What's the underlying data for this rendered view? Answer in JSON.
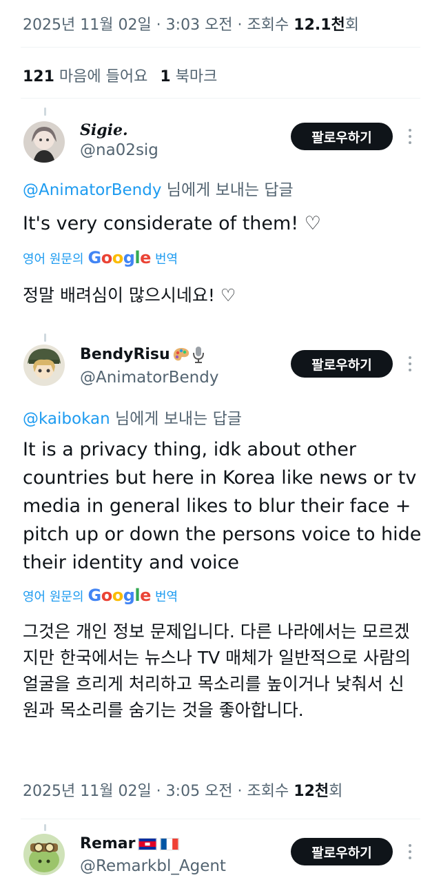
{
  "post_meta": {
    "date": "2025년 11월 02일",
    "sep1": " · ",
    "time": "3:03 오전",
    "sep2": " · ",
    "views_label": "조회수 ",
    "views_num": "12.1천",
    "views_suffix": "회"
  },
  "engagement": {
    "likes_num": "121",
    "likes_label": " 마음에 들어요",
    "bookmarks_num": "1",
    "bookmarks_label": " 북마크"
  },
  "replies": [
    {
      "display_name": "Sigie.",
      "handle": "@na02sig",
      "follow_label": "팔로우하기",
      "reply_to_mention": "@AnimatorBendy",
      "reply_to_suffix": " 님에게 보내는 답글",
      "text": "It's very considerate of them! ♡",
      "translate_prefix": "영어 원문의",
      "translate_suffix": "번역",
      "translation": "정말 배려심이 많으시네요! ♡"
    },
    {
      "display_name": "BendyRisu",
      "handle": "@AnimatorBendy",
      "follow_label": "팔로우하기",
      "reply_to_mention": "@kaibokan",
      "reply_to_suffix": " 님에게 보내는 답글",
      "text": "It is a privacy thing, idk about other countries but here in Korea like news or tv media in general likes to blur their face + pitch up or down the persons voice to hide their identity and voice",
      "translate_prefix": "영어 원문의",
      "translate_suffix": "번역",
      "translation": "그것은 개인 정보 문제입니다. 다른 나라에서는 모르겠지만 한국에서는 뉴스나 TV 매체가 일반적으로 사람의 얼굴을 흐리게 처리하고 목소리를 높이거나 낮춰서 신원과 목소리를 숨기는 것을 좋아합니다.",
      "meta": {
        "date": "2025년 11월 02일",
        "sep1": " · ",
        "time": "3:05 오전",
        "sep2": " · ",
        "views_label": "조회수 ",
        "views_num": "12천",
        "views_suffix": "회"
      }
    },
    {
      "display_name": "Remar",
      "handle": "@Remarkbl_Agent",
      "follow_label": "팔로우하기"
    }
  ],
  "google_logo_text": "Google",
  "icons": {
    "more": "more-dots-icon",
    "palette_emoji": "palette-emoji-icon",
    "microphone_emoji": "microphone-emoji-icon",
    "cambodia_flag": "cambodia-flag-icon",
    "france_flag": "france-flag-icon"
  },
  "colors": {
    "link": "#1d9bf0",
    "secondary_text": "#536471",
    "follow_button": "#0f1419"
  }
}
